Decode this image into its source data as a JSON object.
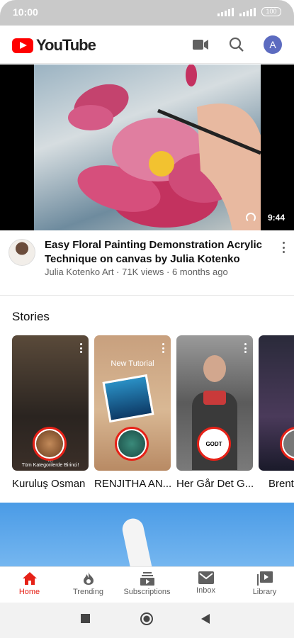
{
  "status_bar": {
    "time": "10:00",
    "battery": "100"
  },
  "app_bar": {
    "logo_text": "YouTube",
    "avatar_letter": "A"
  },
  "video": {
    "duration": "9:44",
    "title": "Easy Floral Painting Demonstration Acrylic Technique on canvas by Julia Kotenko",
    "channel": "Julia Kotenko Art",
    "views": "71K views",
    "age": "6 months ago",
    "separator": " · "
  },
  "stories": {
    "title": "Stories",
    "items": [
      {
        "name": "Kuruluş Osman",
        "overlay": "İlk\nTüm Kategorilerde Birinci!"
      },
      {
        "name": "RENJITHA AN...",
        "overlay": "New Tutorial"
      },
      {
        "name": "Her Går Det G...",
        "overlay": "GODT"
      },
      {
        "name": "Brent",
        "overlay": ""
      }
    ]
  },
  "bottom_nav": [
    {
      "label": "Home",
      "icon": "home-icon",
      "active": true
    },
    {
      "label": "Trending",
      "icon": "flame-icon",
      "active": false
    },
    {
      "label": "Subscriptions",
      "icon": "subscriptions-icon",
      "active": false
    },
    {
      "label": "Inbox",
      "icon": "inbox-icon",
      "active": false
    },
    {
      "label": "Library",
      "icon": "library-icon",
      "active": false
    }
  ],
  "colors": {
    "brand": "#ff0000",
    "active": "#e62117",
    "secondary_text": "#606060"
  }
}
